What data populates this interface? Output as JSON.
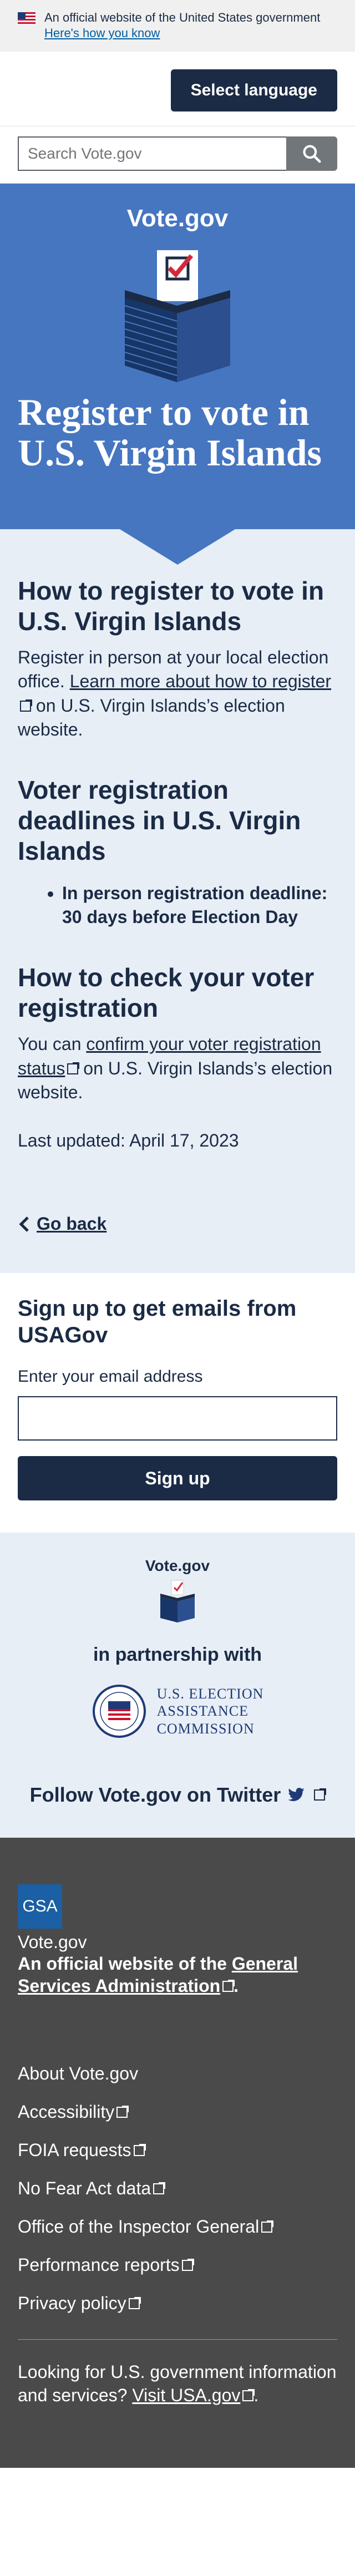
{
  "banner": {
    "text": "An official website of the United States government",
    "link": "Here's how you know"
  },
  "language_button": "Select language",
  "search": {
    "placeholder": "Search Vote.gov"
  },
  "hero": {
    "brand": "Vote.gov",
    "title": "Register to vote in U.S. Virgin Islands"
  },
  "register": {
    "heading": "How to register to vote in U.S. Virgin Islands",
    "text_before": "Register in person at your local election office. ",
    "link": "Learn more about how to register",
    "text_after": " on U.S. Virgin Islands’s election website."
  },
  "deadlines": {
    "heading": "Voter registration deadlines in U.S. Virgin Islands",
    "items": [
      {
        "label": "In person registration deadline:",
        "value": " 30 days before Election Day"
      }
    ]
  },
  "check": {
    "heading": "How to check your voter registration",
    "text_before": "You can ",
    "link": "confirm your voter registration status",
    "text_after": " on U.S. Virgin Islands’s election website."
  },
  "last_updated": "Last updated: April 17, 2023",
  "back_link": "Go back",
  "signup": {
    "heading": "Sign up to get emails from USAGov",
    "label": "Enter your email address",
    "button": "Sign up"
  },
  "partners": {
    "brand": "Vote.gov",
    "partnership": "in partnership with",
    "eac_lines": [
      "U.S. ELECTION",
      "ASSISTANCE",
      "COMMISSION"
    ],
    "twitter": "Follow Vote.gov on Twitter"
  },
  "footer": {
    "logo": "GSA",
    "name": "Vote.gov",
    "official_before": "An official website of the ",
    "official_link": "General Services Administration",
    "official_after": ".",
    "links": [
      "About Vote.gov",
      "Accessibility",
      "FOIA requests",
      "No Fear Act data",
      "Office of the Inspector General",
      "Performance reports",
      "Privacy policy"
    ],
    "looking_before": "Looking for U.S. government information and services? ",
    "looking_link": "Visit USA.gov",
    "looking_after": "."
  }
}
